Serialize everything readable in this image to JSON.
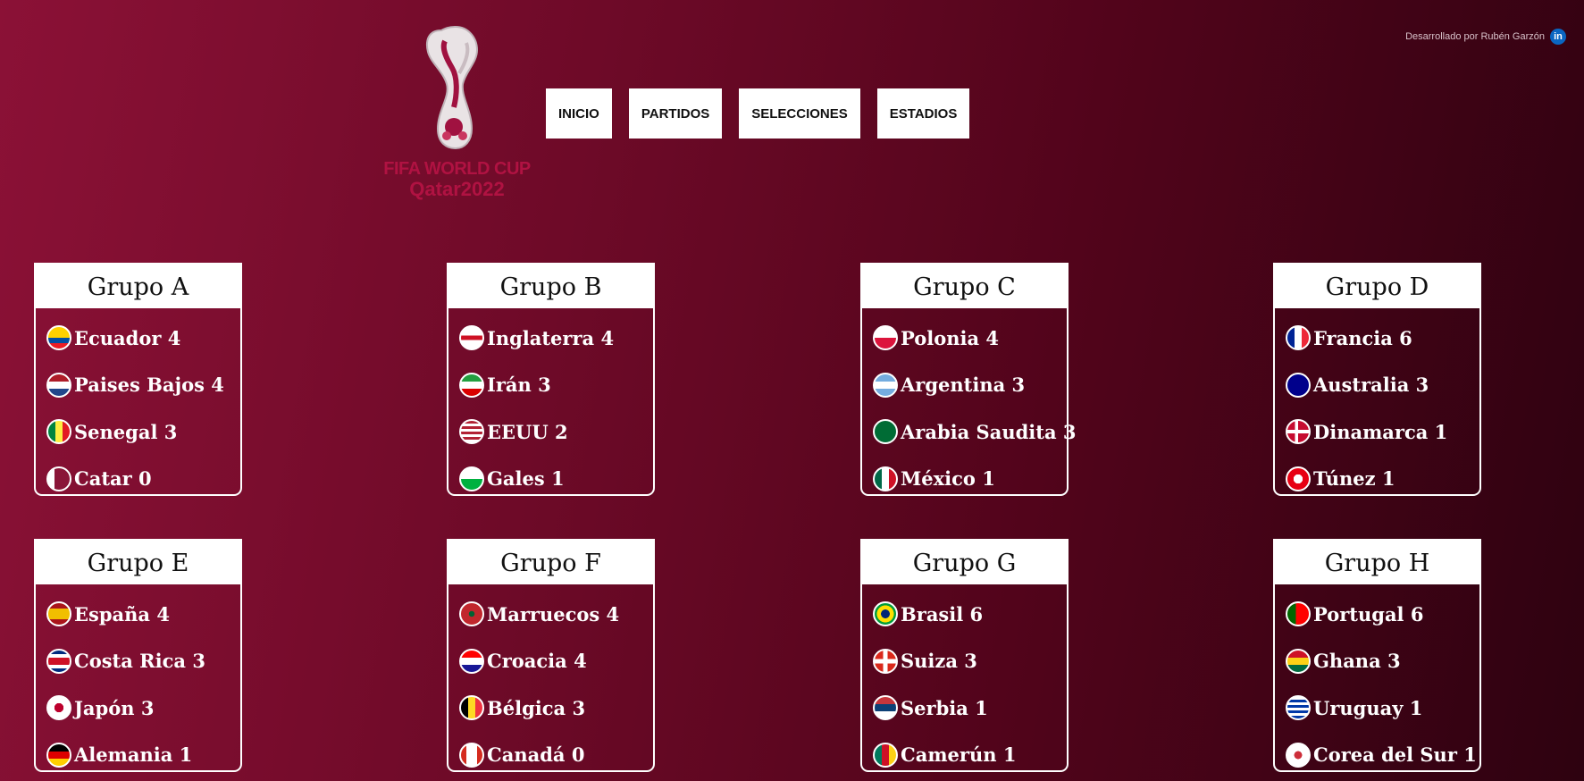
{
  "credit": {
    "text": "Desarrollado por Rubén Garzón",
    "icon": "linkedin-icon",
    "icon_label": "in"
  },
  "logo": {
    "line1": "FIFA WORLD CUP",
    "line2": "Qatar2022"
  },
  "nav": [
    {
      "label": "INICIO"
    },
    {
      "label": "PARTIDOS"
    },
    {
      "label": "SELECCIONES"
    },
    {
      "label": "ESTADIOS"
    }
  ],
  "groups": [
    {
      "title": "Grupo A",
      "teams": [
        {
          "name": "Ecuador",
          "pts": "4",
          "flag": "ecuador"
        },
        {
          "name": "Paises Bajos",
          "pts": "4",
          "flag": "netherlands"
        },
        {
          "name": "Senegal",
          "pts": "3",
          "flag": "senegal"
        },
        {
          "name": "Catar",
          "pts": "0",
          "flag": "qatar"
        }
      ]
    },
    {
      "title": "Grupo B",
      "teams": [
        {
          "name": "Inglaterra",
          "pts": "4",
          "flag": "england"
        },
        {
          "name": "Irán",
          "pts": "3",
          "flag": "iran"
        },
        {
          "name": "EEUU",
          "pts": "2",
          "flag": "usa"
        },
        {
          "name": "Gales",
          "pts": "1",
          "flag": "wales"
        }
      ]
    },
    {
      "title": "Grupo C",
      "teams": [
        {
          "name": "Polonia",
          "pts": "4",
          "flag": "poland"
        },
        {
          "name": "Argentina",
          "pts": "3",
          "flag": "argentina"
        },
        {
          "name": "Arabia Saudita",
          "pts": "3",
          "flag": "saudi-arabia"
        },
        {
          "name": "México",
          "pts": "1",
          "flag": "mexico"
        }
      ]
    },
    {
      "title": "Grupo D",
      "teams": [
        {
          "name": "Francia",
          "pts": "6",
          "flag": "france"
        },
        {
          "name": "Australia",
          "pts": "3",
          "flag": "australia"
        },
        {
          "name": "Dinamarca",
          "pts": "1",
          "flag": "denmark"
        },
        {
          "name": "Túnez",
          "pts": "1",
          "flag": "tunisia"
        }
      ]
    },
    {
      "title": "Grupo E",
      "teams": [
        {
          "name": "España",
          "pts": "4",
          "flag": "spain"
        },
        {
          "name": "Costa Rica",
          "pts": "3",
          "flag": "costa-rica"
        },
        {
          "name": "Japón",
          "pts": "3",
          "flag": "japan"
        },
        {
          "name": "Alemania",
          "pts": "1",
          "flag": "germany"
        }
      ]
    },
    {
      "title": "Grupo F",
      "teams": [
        {
          "name": "Marruecos",
          "pts": "4",
          "flag": "morocco"
        },
        {
          "name": "Croacia",
          "pts": "4",
          "flag": "croatia"
        },
        {
          "name": "Bélgica",
          "pts": "3",
          "flag": "belgium"
        },
        {
          "name": "Canadá",
          "pts": "0",
          "flag": "canada"
        }
      ]
    },
    {
      "title": "Grupo G",
      "teams": [
        {
          "name": "Brasil",
          "pts": "6",
          "flag": "brazil"
        },
        {
          "name": "Suiza",
          "pts": "3",
          "flag": "switzerland"
        },
        {
          "name": "Serbia",
          "pts": "1",
          "flag": "serbia"
        },
        {
          "name": "Camerún",
          "pts": "1",
          "flag": "cameroon"
        }
      ]
    },
    {
      "title": "Grupo H",
      "teams": [
        {
          "name": "Portugal",
          "pts": "6",
          "flag": "portugal"
        },
        {
          "name": "Ghana",
          "pts": "3",
          "flag": "ghana"
        },
        {
          "name": "Uruguay",
          "pts": "1",
          "flag": "uruguay"
        },
        {
          "name": "Corea del Sur",
          "pts": "1",
          "flag": "south-korea"
        }
      ]
    }
  ]
}
